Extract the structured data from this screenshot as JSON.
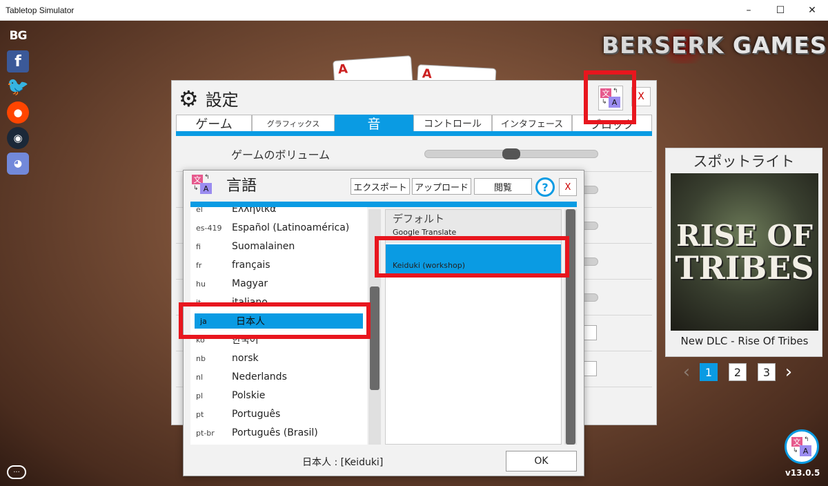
{
  "window": {
    "title": "Tabletop Simulator",
    "minimize": "–",
    "maximize": "☐",
    "close": "✕"
  },
  "social": {
    "bg": "BG",
    "facebook": "f",
    "twitter": "🐦",
    "reddit": "●",
    "steam": "◉",
    "discord": "◕"
  },
  "brand": {
    "name_a": "BERSERK",
    "name_b": "GAMES"
  },
  "spotlight": {
    "title": "スポットライト",
    "logo_line1": "RISE OF",
    "logo_line2": "TRIBES",
    "caption": "New DLC - Rise Of Tribes",
    "prev": "‹",
    "next": "›",
    "pages": [
      "1",
      "2",
      "3"
    ],
    "active_page": 1
  },
  "version": "v13.0.5",
  "translate_glyph": {
    "src": "文",
    "dst": "A",
    "arrow1": "↰",
    "arrow2": "↳"
  },
  "cards": {
    "c1": "A",
    "c2": "A"
  },
  "settings": {
    "gear": "⚙",
    "title": "設定",
    "close": "X",
    "tabs": [
      {
        "label": "ゲーム",
        "active": false
      },
      {
        "label": "グラフィックス",
        "active": false
      },
      {
        "label": "音",
        "active": true
      },
      {
        "label": "コントロール",
        "active": false
      },
      {
        "label": "インタフェース",
        "active": false
      },
      {
        "label": "ブロック",
        "active": false
      }
    ],
    "rows": [
      {
        "label": "ゲームのボリューム",
        "value": 0.5
      }
    ]
  },
  "language": {
    "title": "言語",
    "buttons": {
      "export": "エクスポート",
      "upload": "アップロード",
      "browse": "閲覧",
      "help": "?",
      "close": "X"
    },
    "items": [
      {
        "code": "el",
        "name": "Ελληνικά"
      },
      {
        "code": "es-419",
        "name": "Español (Latinoamérica)"
      },
      {
        "code": "fi",
        "name": "Suomalainen"
      },
      {
        "code": "fr",
        "name": "français"
      },
      {
        "code": "hu",
        "name": "Magyar"
      },
      {
        "code": "it",
        "name": "italiano"
      },
      {
        "code": "ja",
        "name": "日本人"
      },
      {
        "code": "ko",
        "name": "한국어"
      },
      {
        "code": "nb",
        "name": "norsk"
      },
      {
        "code": "nl",
        "name": "Nederlands"
      },
      {
        "code": "pl",
        "name": "Polskie"
      },
      {
        "code": "pt",
        "name": "Português"
      },
      {
        "code": "pt-br",
        "name": "Português (Brasil)"
      }
    ],
    "selected_code": "ja",
    "translations": {
      "default_label": "デフォルト",
      "google": "Google Translate",
      "selected": "Keiduki (workshop)"
    },
    "status": "日本人 : [Keiduki]",
    "ok": "OK"
  },
  "colors": {
    "accent": "#0a9be3",
    "highlight": "#e8161e"
  },
  "chat_icon": "···"
}
